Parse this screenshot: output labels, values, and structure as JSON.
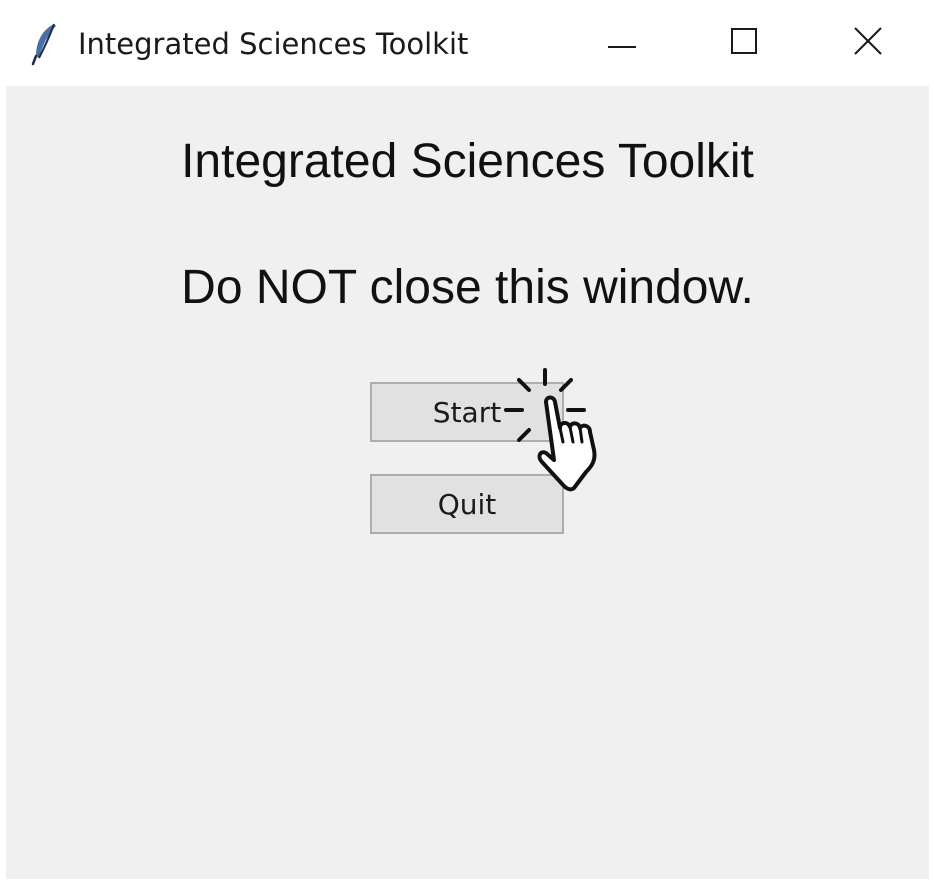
{
  "window": {
    "title": "Integrated Sciences Toolkit",
    "icon": "feather-icon",
    "controls": [
      "minimize-icon",
      "maximize-icon",
      "close-icon"
    ]
  },
  "main": {
    "title": "Integrated Sciences Toolkit",
    "warning": "Do NOT close this window.",
    "buttons": {
      "start_label": "Start",
      "quit_label": "Quit"
    }
  },
  "cursor": {
    "icon": "hand-pointer-click-icon"
  },
  "colors": {
    "client_background": "#f0f0f0",
    "button_face": "#e1e1e1",
    "button_border": "#adadad",
    "titlebar": "#ffffff"
  }
}
